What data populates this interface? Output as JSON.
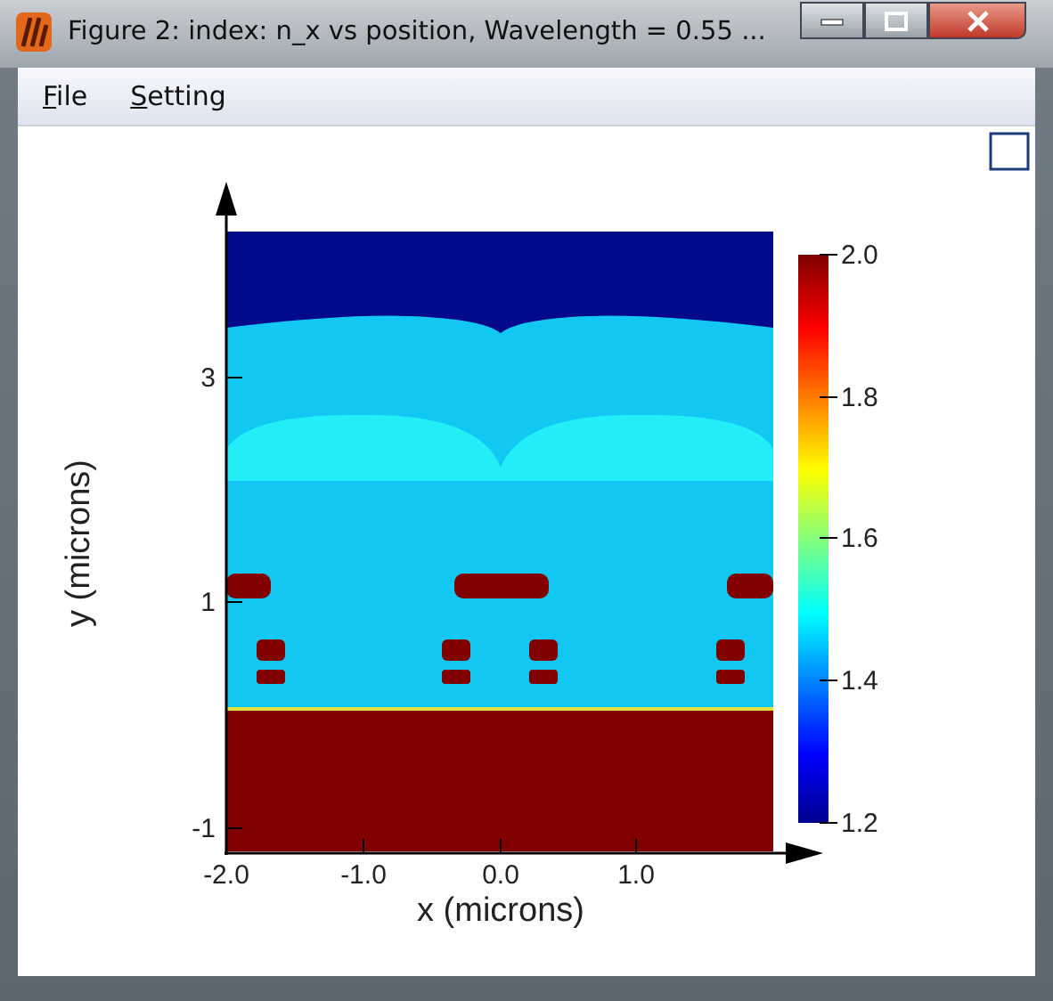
{
  "window": {
    "title": "Figure 2: index: n_x vs position, Wavelength = 0.55 ..."
  },
  "menu": [
    {
      "label": "File"
    },
    {
      "label": "Setting"
    }
  ],
  "plot": {
    "xlabel": "x (microns)",
    "ylabel": "y (microns)",
    "xticks": [
      "-2.0",
      "-1.0",
      "0.0",
      "1.0"
    ],
    "yticks": [
      "3",
      "1",
      "-1"
    ],
    "colorbar_ticks": [
      "2.0",
      "1.8",
      "1.6",
      "1.4",
      "1.2"
    ]
  }
}
